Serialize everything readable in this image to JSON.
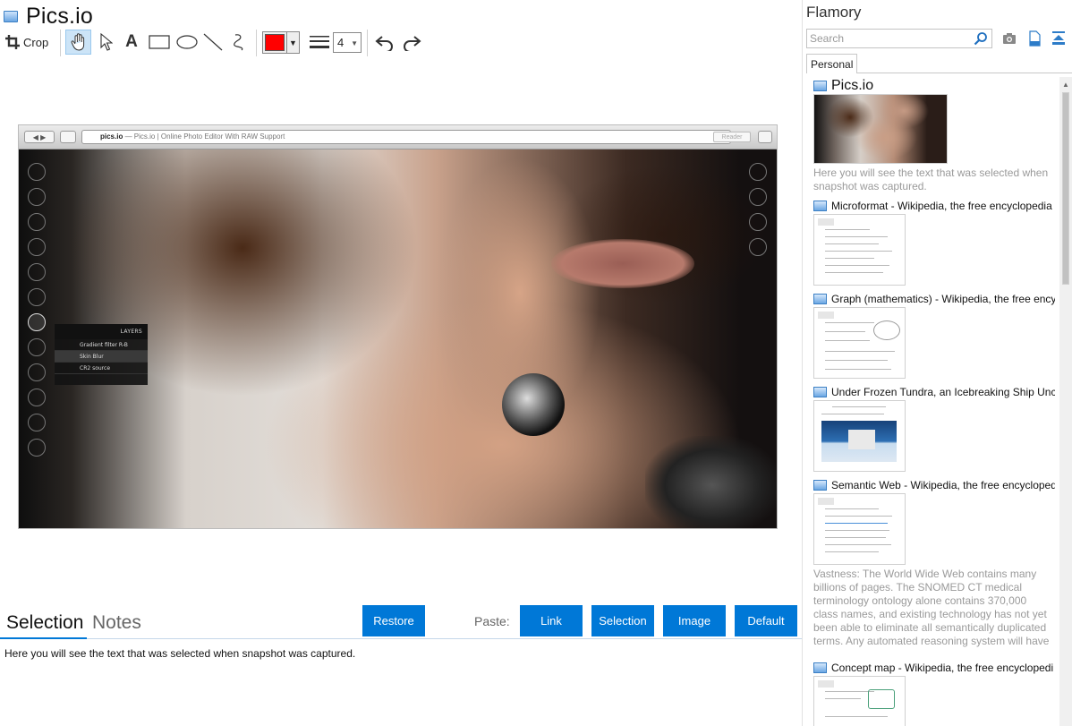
{
  "editor": {
    "title": "Pics.io",
    "toolbar": {
      "crop_label": "Crop",
      "text_tool": "A",
      "color": "#ff0000",
      "line_width": "4"
    },
    "screenshot": {
      "url_host": "pics.io",
      "url_rest": " — Pics.io | Online Photo Editor With RAW Support",
      "reader_label": "Reader",
      "layers_title": "LAYERS",
      "layers": [
        "Gradient filter R-B",
        "Skin Blur",
        "CR2 source"
      ]
    },
    "tabs": [
      "Selection",
      "Notes"
    ],
    "buttons": {
      "restore": "Restore",
      "paste_label": "Paste:",
      "link": "Link",
      "selection": "Selection",
      "image": "Image",
      "default": "Default"
    },
    "selection_text": "Here you will see the text that was selected when snapshot was captured."
  },
  "flamory": {
    "title": "Flamory",
    "search_placeholder": "Search",
    "tab": "Personal",
    "items": [
      {
        "title": "Pics.io",
        "desc": "Here you will see the text that was selected when snapshot was captured."
      },
      {
        "title": "Microformat - Wikipedia, the free encyclopedia"
      },
      {
        "title": "Graph (mathematics) - Wikipedia, the free ency"
      },
      {
        "title": "Under Frozen Tundra, an Icebreaking Ship Unco"
      },
      {
        "title": "Semantic Web - Wikipedia, the free encycloped",
        "desc": "Vastness: The World Wide Web contains many billions of pages. The SNOMED CT medical terminology ontology alone contains 370,000 class names, and existing technology has not yet been able to eliminate all semantically duplicated terms. Any automated reasoning system will have to deal with truly huge inputs."
      },
      {
        "title": "Concept map - Wikipedia, the free encyclopedi"
      }
    ]
  }
}
